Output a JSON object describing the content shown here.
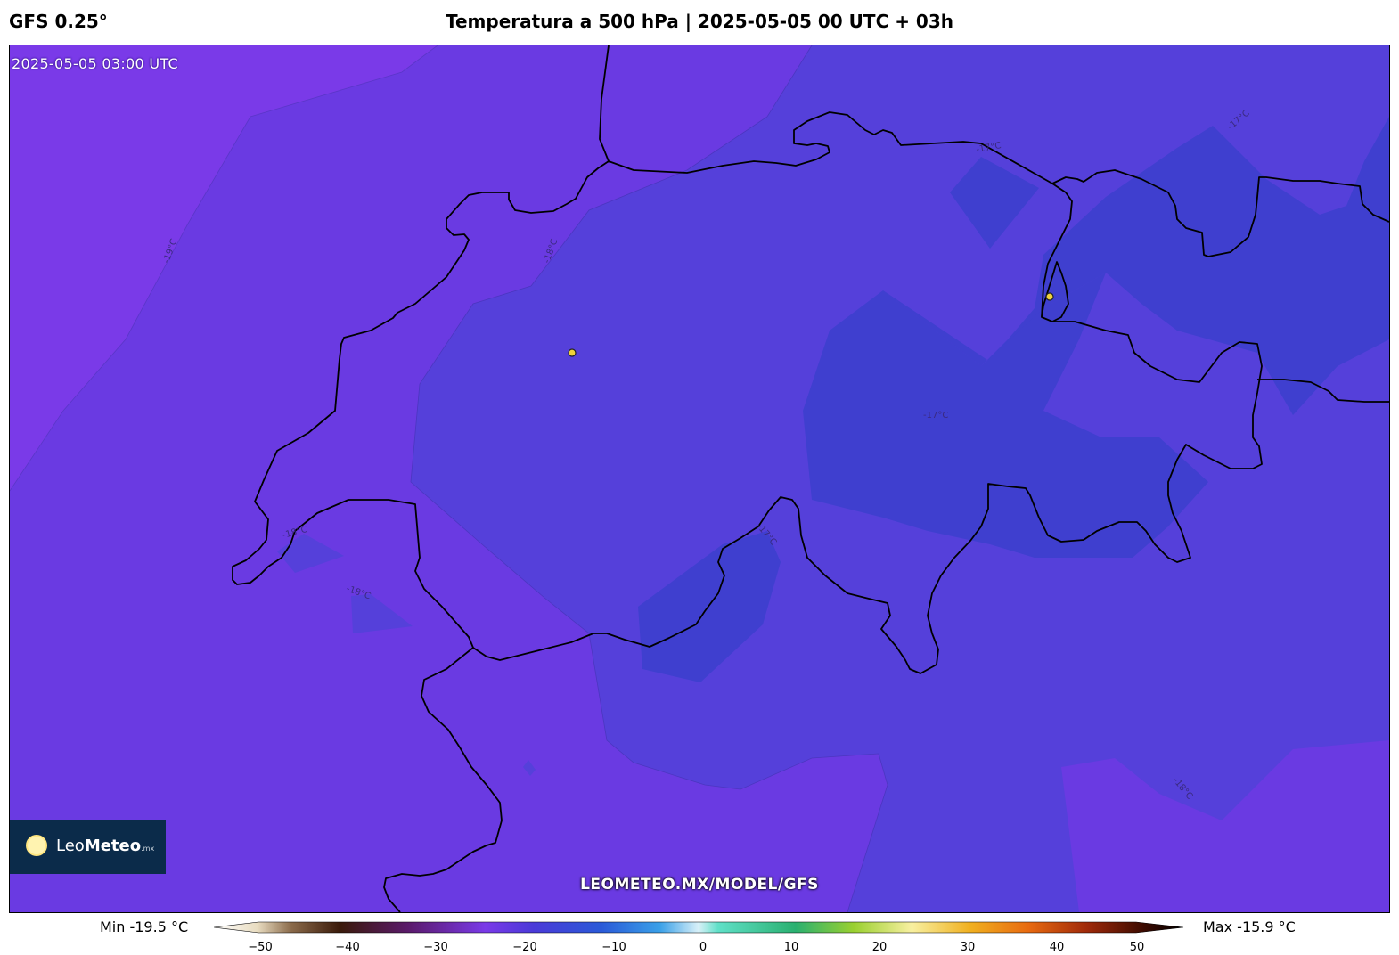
{
  "header": {
    "model": "GFS 0.25°",
    "title": "Temperatura a 500 hPa | 2025-05-05 00 UTC + 03h"
  },
  "map": {
    "valid_time": "2025-05-05 03:00 UTC",
    "website": "LEOMETEO.MX/MODEL/GFS",
    "contour_labels": [
      "-19°C",
      "-18°C",
      "-17°C",
      "-17°C",
      "-17°C",
      "-18°C",
      "-18°C",
      "-17°C",
      "-18°C"
    ],
    "fill_colors": {
      "minus19": "#7a3ae8",
      "minus18": "#6a3ae2",
      "minus17": "#5540da",
      "minus16": "#3f3fcf"
    },
    "marker_color": "#f0d23c"
  },
  "logo": {
    "name_light": "Leo",
    "name_bold": "Meteo",
    "suffix": ".mx"
  },
  "colorbar": {
    "min_label": "Min -19.5 °C",
    "max_label": "Max -15.9 °C",
    "ticks": [
      "−50",
      "−40",
      "−30",
      "−20",
      "−10",
      "0",
      "10",
      "20",
      "30",
      "40",
      "50"
    ],
    "range": [
      -50,
      50
    ]
  }
}
